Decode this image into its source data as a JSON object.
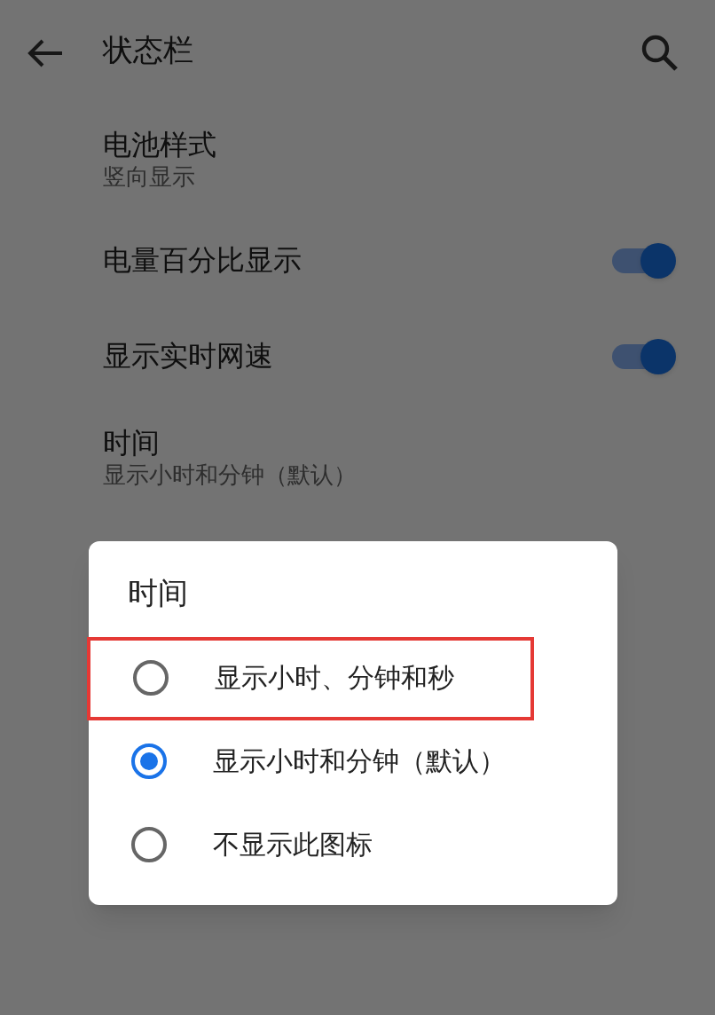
{
  "app_bar": {
    "title": "状态栏"
  },
  "settings": [
    {
      "kind": "text",
      "title": "电池样式",
      "summary": "竖向显示"
    },
    {
      "kind": "switch",
      "title": "电量百分比显示",
      "on": true
    },
    {
      "kind": "switch",
      "title": "显示实时网速",
      "on": true
    },
    {
      "kind": "text",
      "title": "时间",
      "summary": "显示小时和分钟（默认）"
    }
  ],
  "dialog": {
    "title": "时间",
    "options": [
      {
        "label": "显示小时、分钟和秒",
        "selected": false,
        "highlighted": true
      },
      {
        "label": "显示小时和分钟（默认）",
        "selected": true,
        "highlighted": false
      },
      {
        "label": "不显示此图标",
        "selected": false,
        "highlighted": false
      }
    ]
  }
}
